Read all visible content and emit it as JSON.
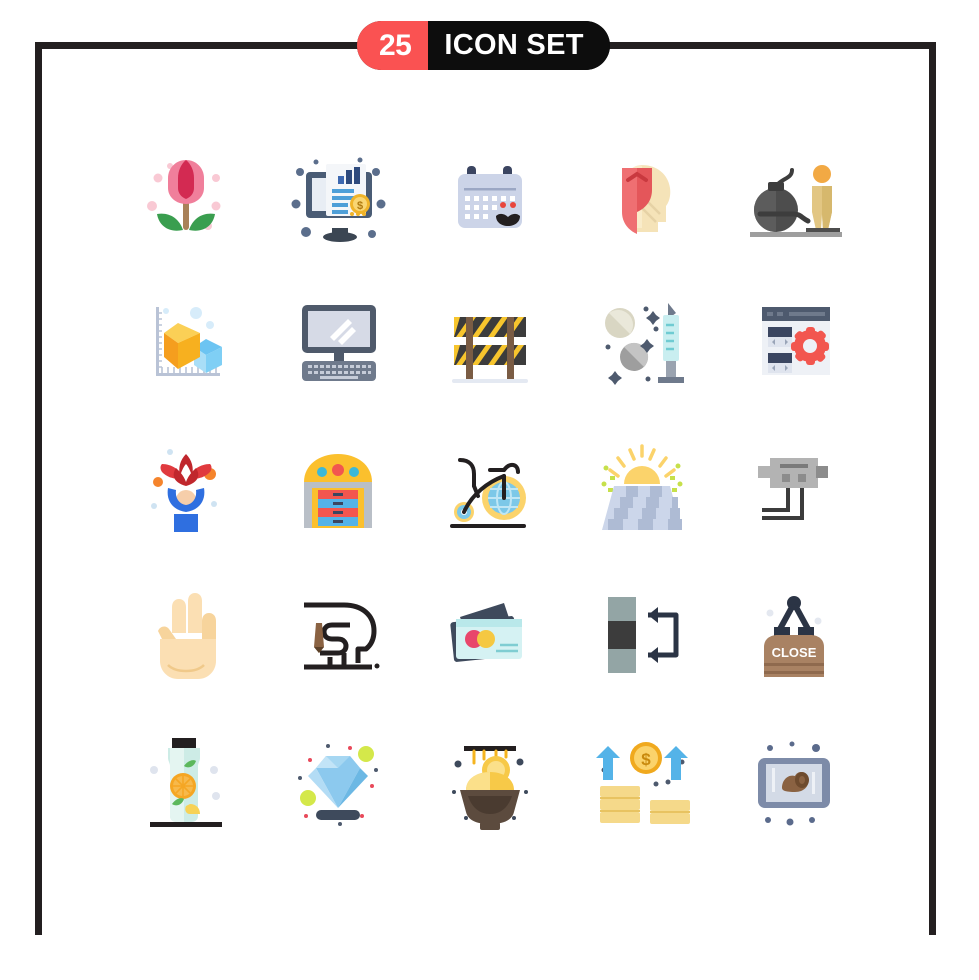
{
  "header": {
    "count": "25",
    "title": "Icon Set",
    "badge_red": "#fa5252",
    "badge_black": "#0d0d0d",
    "frame_color": "#231f20"
  },
  "grid": {
    "columns": 5,
    "rows": 5,
    "total": 25
  },
  "icons": [
    {
      "index": 1,
      "name": "tulip-flower",
      "label": "Flower"
    },
    {
      "index": 2,
      "name": "financial-report-monitor",
      "label": "Financial Report"
    },
    {
      "index": 3,
      "name": "movember-calendar",
      "label": "Movember Calendar"
    },
    {
      "index": 4,
      "name": "head-shield-protection",
      "label": "Mental Protection"
    },
    {
      "index": 5,
      "name": "bomb-hazard-person",
      "label": "Bomb"
    },
    {
      "index": 6,
      "name": "3d-cube-chart",
      "label": "3D Chart"
    },
    {
      "index": 7,
      "name": "desktop-computer",
      "label": "Computer"
    },
    {
      "index": 8,
      "name": "road-barrier",
      "label": "Barrier"
    },
    {
      "index": 9,
      "name": "pills-syringe",
      "label": "Medicine"
    },
    {
      "index": 10,
      "name": "browser-settings-gear",
      "label": "Browser Settings"
    },
    {
      "index": 11,
      "name": "person-celebration-lotus",
      "label": "Celebration"
    },
    {
      "index": 12,
      "name": "slot-machine",
      "label": "Slot Machine"
    },
    {
      "index": 13,
      "name": "vintage-bicycle-globe",
      "label": "Bicycle"
    },
    {
      "index": 14,
      "name": "sunrise-field",
      "label": "Sunrise"
    },
    {
      "index": 15,
      "name": "machine-component",
      "label": "Component"
    },
    {
      "index": 16,
      "name": "hand-two-fingers",
      "label": "Hand Gesture"
    },
    {
      "index": 17,
      "name": "creative-mind-maze",
      "label": "Creative Mind"
    },
    {
      "index": 18,
      "name": "credit-cards",
      "label": "Credit Cards"
    },
    {
      "index": 19,
      "name": "transfer-swap",
      "label": "Transfer"
    },
    {
      "index": 20,
      "name": "close-sign",
      "label": "Close Sign",
      "sign_text": "CLOSE"
    },
    {
      "index": 21,
      "name": "detox-water-jar",
      "label": "Detox Water"
    },
    {
      "index": 22,
      "name": "diamond",
      "label": "Diamond"
    },
    {
      "index": 23,
      "name": "honey-bowl",
      "label": "Honey Bowl"
    },
    {
      "index": 24,
      "name": "coin-stacks-growth",
      "label": "Money Growth"
    },
    {
      "index": 25,
      "name": "framed-picture",
      "label": "Framed Picture"
    }
  ]
}
